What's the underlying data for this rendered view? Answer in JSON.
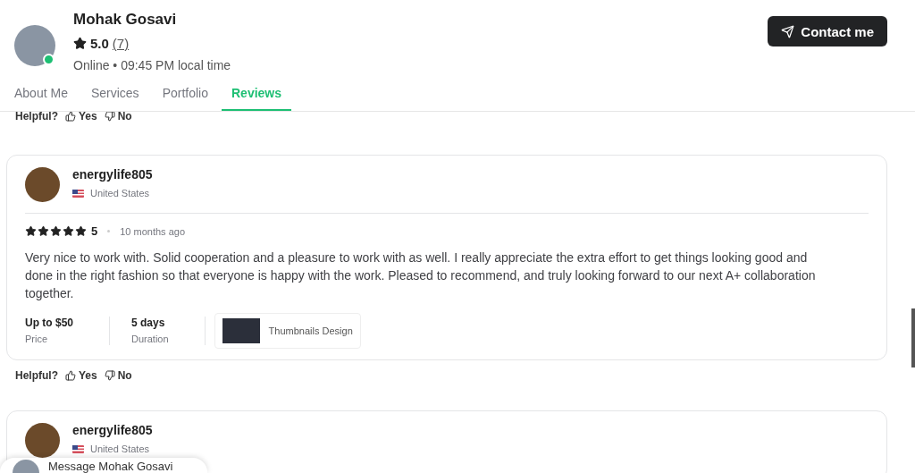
{
  "profile": {
    "name": "Mohak Gosavi",
    "rating": "5.0",
    "review_count": "(7)",
    "online": true,
    "status": "Online • 09:45 PM local time"
  },
  "contact_button": "Contact me",
  "tabs": [
    {
      "label": "About Me",
      "selected": false
    },
    {
      "label": "Services",
      "selected": false
    },
    {
      "label": "Portfolio",
      "selected": false
    },
    {
      "label": "Reviews",
      "selected": true
    }
  ],
  "top_helpful": {
    "question": "Helpful?",
    "yes": "Yes",
    "no": "No"
  },
  "reviews": [
    {
      "user": "energylife805",
      "country": "United States",
      "stars": 5,
      "score": "5",
      "time": "10 months ago",
      "text": "Very nice to work with. Solid cooperation and a pleasure to work with as well. I really appreciate the extra effort to get things looking good and done in the right fashion so that everyone is happy with the work. Pleased to recommend, and truly looking forward to our next A+ collaboration together.",
      "price": "Up to $50",
      "price_label": "Price",
      "duration": "5 days",
      "duration_label": "Duration",
      "service": "Thumbnails Design",
      "helpful": {
        "question": "Helpful?",
        "yes": "Yes",
        "no": "No"
      }
    },
    {
      "user": "energylife805",
      "country": "United States"
    }
  ],
  "message_bar": "Message Mohak Gosavi"
}
